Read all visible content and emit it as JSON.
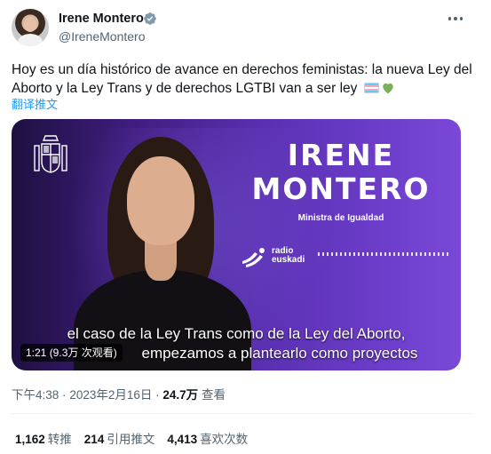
{
  "author": {
    "name": "Irene Montero",
    "handle": "@IreneMontero"
  },
  "tweet": {
    "text": "Hoy es un día histórico de avance en derechos feministas: la nueva Ley del Aborto y la Ley Trans y de derechos LGTBI van a ser ley",
    "emojis": [
      "transgender-flag",
      "green-heart"
    ],
    "translate_label": "翻译推文"
  },
  "media": {
    "title": "IRENE MONTERO",
    "role": "Ministra de Igualdad",
    "radio_line1": "radio",
    "radio_line2": "euskadi",
    "subtitle_line1": "el caso de la Ley Trans como de la Ley del Aborto,",
    "subtitle_line2": "empezamos a plantearlo como proyectos",
    "duration_label": "1:21 (9.3万 次观看)",
    "colors": {
      "bg_start": "#1e1040",
      "bg_end": "#7a48d8"
    }
  },
  "meta": {
    "time": "下午4:38",
    "separator": "·",
    "date": "2023年2月16日",
    "views": "24.7万",
    "views_label": "查看"
  },
  "stats": {
    "retweets": "1,162",
    "retweets_label": "转推",
    "quotes": "214",
    "quotes_label": "引用推文",
    "likes": "4,413",
    "likes_label": "喜欢次数"
  },
  "colors": {
    "accent": "#1d9bf0",
    "text": "#0f1419",
    "muted": "#536471"
  }
}
